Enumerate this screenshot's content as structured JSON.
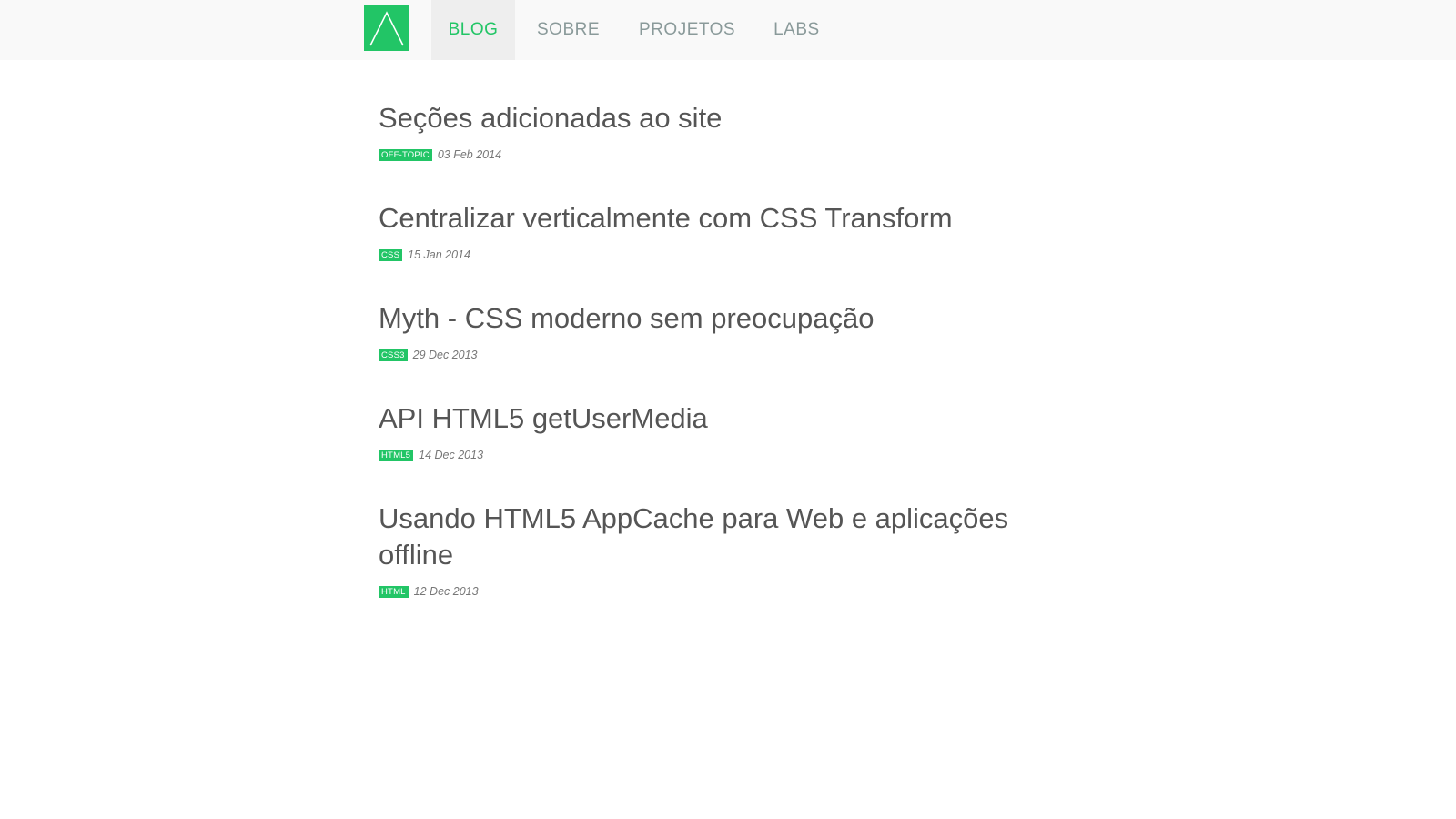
{
  "nav": {
    "items": [
      {
        "label": "BLOG",
        "active": true
      },
      {
        "label": "SOBRE",
        "active": false
      },
      {
        "label": "PROJETOS",
        "active": false
      },
      {
        "label": "LABS",
        "active": false
      }
    ]
  },
  "posts": [
    {
      "title": "Seções adicionadas ao site",
      "tag": "OFF-TOPIC",
      "date": "03 Feb 2014"
    },
    {
      "title": "Centralizar verticalmente com CSS Transform",
      "tag": "CSS",
      "date": "15 Jan 2014"
    },
    {
      "title": "Myth - CSS moderno sem preocupação",
      "tag": "CSS3",
      "date": "29 Dec 2013"
    },
    {
      "title": "API HTML5 getUserMedia",
      "tag": "HTML5",
      "date": "14 Dec 2013"
    },
    {
      "title": "Usando HTML5 AppCache para Web e aplicações offline",
      "tag": "HTML",
      "date": "12 Dec 2013"
    }
  ],
  "colors": {
    "accent": "#22c566",
    "nav_bg": "#f9f9f9",
    "nav_active_bg": "#eeeeee",
    "nav_text": "#8a9a9a",
    "title_text": "#555555"
  },
  "icons": {
    "logo": "triangle-logo-icon"
  }
}
